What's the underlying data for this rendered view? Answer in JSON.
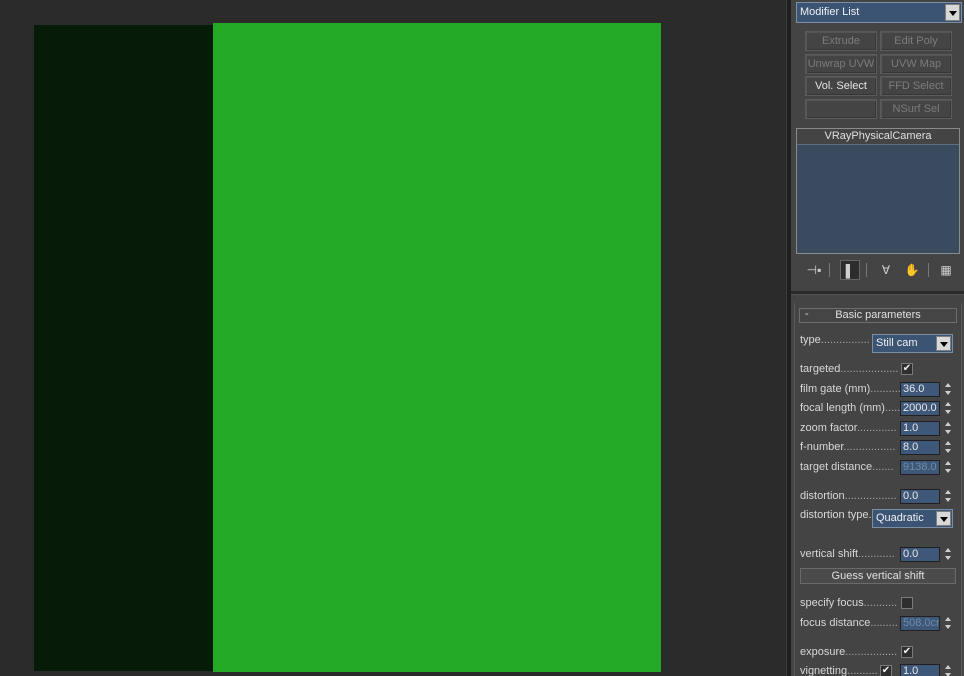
{
  "viewport": {
    "dark_color": "#061c09",
    "light_color": "#24a926"
  },
  "modifier_list": {
    "label": "Modifier List"
  },
  "modifier_buttons": [
    {
      "label": "Extrude",
      "enabled": false
    },
    {
      "label": "Edit Poly",
      "enabled": false
    },
    {
      "label": "Unwrap UVW",
      "enabled": false
    },
    {
      "label": "UVW Map",
      "enabled": false
    },
    {
      "label": "Vol. Select",
      "enabled": true
    },
    {
      "label": "FFD Select",
      "enabled": false
    },
    {
      "label": "",
      "enabled": false
    },
    {
      "label": "NSurf Sel",
      "enabled": false
    }
  ],
  "stack": {
    "item": "VRayPhysicalCamera"
  },
  "stack_tools": [
    "pin-stack-icon",
    "show-end-result-icon",
    "make-unique-icon",
    "remove-modifier-icon",
    "configure-modifier-sets-icon"
  ],
  "rollout": {
    "title": "Basic parameters",
    "toggle": "-",
    "type": {
      "label": "type",
      "dots": "................",
      "value": "Still cam"
    },
    "targeted": {
      "label": "targeted",
      "dots": "...................",
      "checked": true,
      "mark": "✔"
    },
    "film_gate": {
      "label": "film gate (mm)",
      "dots": "...........",
      "value": "36.0"
    },
    "focal_length": {
      "label": "focal length (mm)",
      "dots": ".....",
      "value": "2000.0"
    },
    "zoom_factor": {
      "label": "zoom factor",
      "dots": ".............",
      "value": "1.0"
    },
    "f_number": {
      "label": "f-number",
      "dots": ".................",
      "value": "8.0"
    },
    "target_distance": {
      "label": "target distance",
      "dots": ".......",
      "value": "9138.0"
    },
    "distortion": {
      "label": "distortion",
      "dots": ".................",
      "value": "0.0"
    },
    "distortion_type": {
      "label": "distortion type.",
      "value": "Quadratic"
    },
    "vertical_shift": {
      "label": "vertical shift",
      "dots": "............",
      "value": "0.0"
    },
    "guess_vertical_shift": "Guess vertical shift",
    "specify_focus": {
      "label": "specify focus",
      "dots": "...........",
      "checked": false,
      "mark": ""
    },
    "focus_distance": {
      "label": "focus distance",
      "dots": ".........",
      "value": "508.0cr"
    },
    "exposure": {
      "label": "exposure",
      "dots": ".................",
      "checked": true,
      "mark": "✔"
    },
    "vignetting": {
      "label": "vignetting",
      "dots": "..........",
      "checked": true,
      "mark": "✔",
      "value": "1.0"
    }
  }
}
